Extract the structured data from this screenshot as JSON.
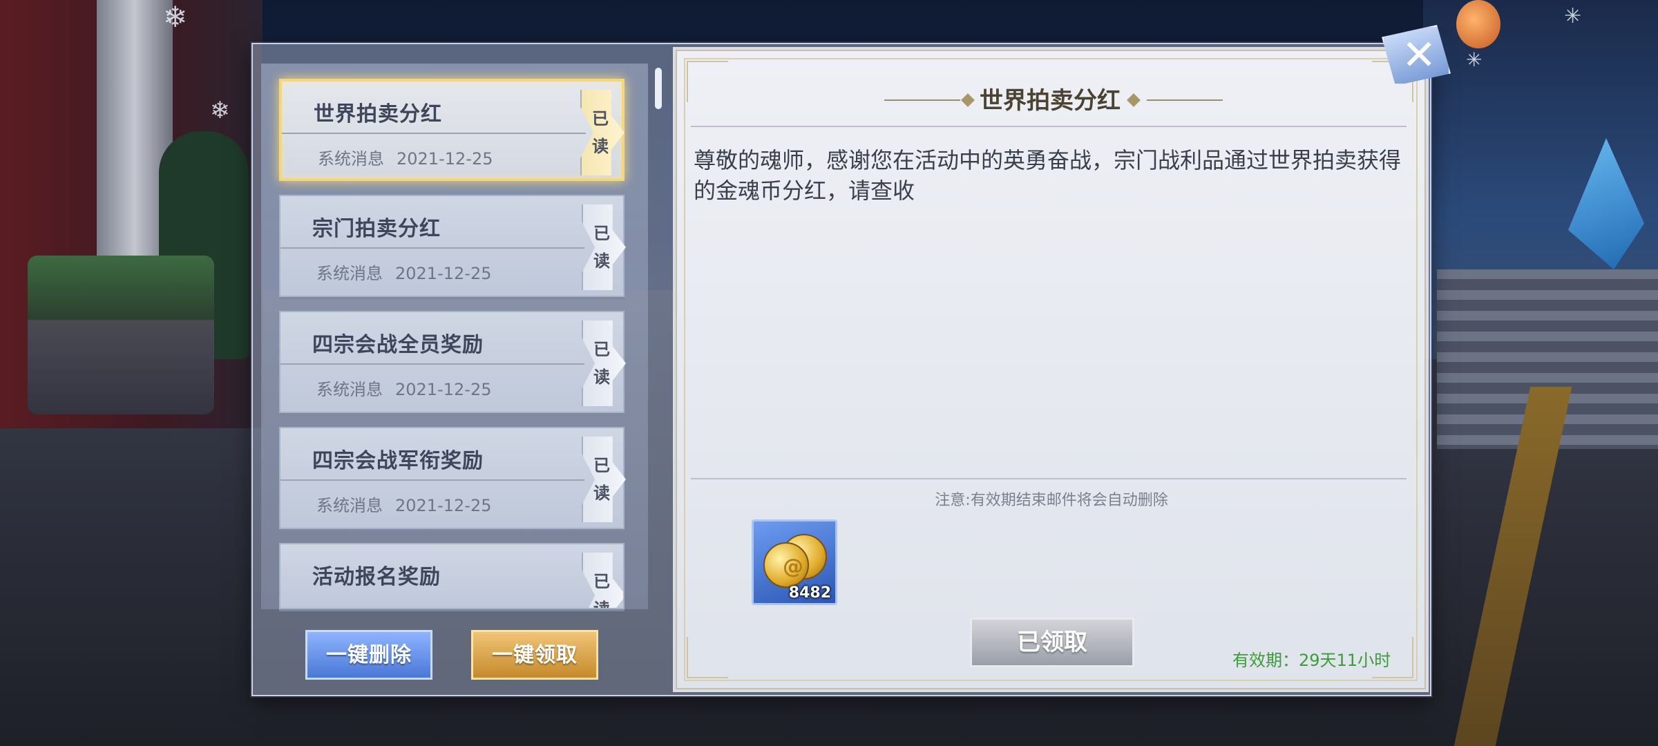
{
  "mail_list": [
    {
      "title": "世界拍卖分红",
      "sender": "系统消息",
      "date": "2021-12-25",
      "status": "已读",
      "selected": true
    },
    {
      "title": "宗门拍卖分红",
      "sender": "系统消息",
      "date": "2021-12-25",
      "status": "已读",
      "selected": false
    },
    {
      "title": "四宗会战全员奖励",
      "sender": "系统消息",
      "date": "2021-12-25",
      "status": "已读",
      "selected": false
    },
    {
      "title": "四宗会战军衔奖励",
      "sender": "系统消息",
      "date": "2021-12-25",
      "status": "已读",
      "selected": false
    },
    {
      "title": "活动报名奖励",
      "sender": "",
      "date": "",
      "status": "已读",
      "selected": false
    }
  ],
  "buttons": {
    "delete_all": "一键删除",
    "claim_all": "一键领取",
    "claimed": "已领取"
  },
  "detail": {
    "title": "世界拍卖分红",
    "body": "尊敬的魂师，感谢您在活动中的英勇奋战，宗门战利品通过世界拍卖获得的金魂币分红，请查收",
    "notice": "注意:有效期结束邮件将会自动删除",
    "reward": {
      "icon": "gold-coin-icon",
      "count": "8482"
    },
    "validity": "有效期：29天11小时"
  },
  "colors": {
    "selected_border": "#f4d77a",
    "delete_button": "#4a78d8",
    "claim_button": "#c68a2c",
    "validity_text": "#3e9a3a"
  }
}
